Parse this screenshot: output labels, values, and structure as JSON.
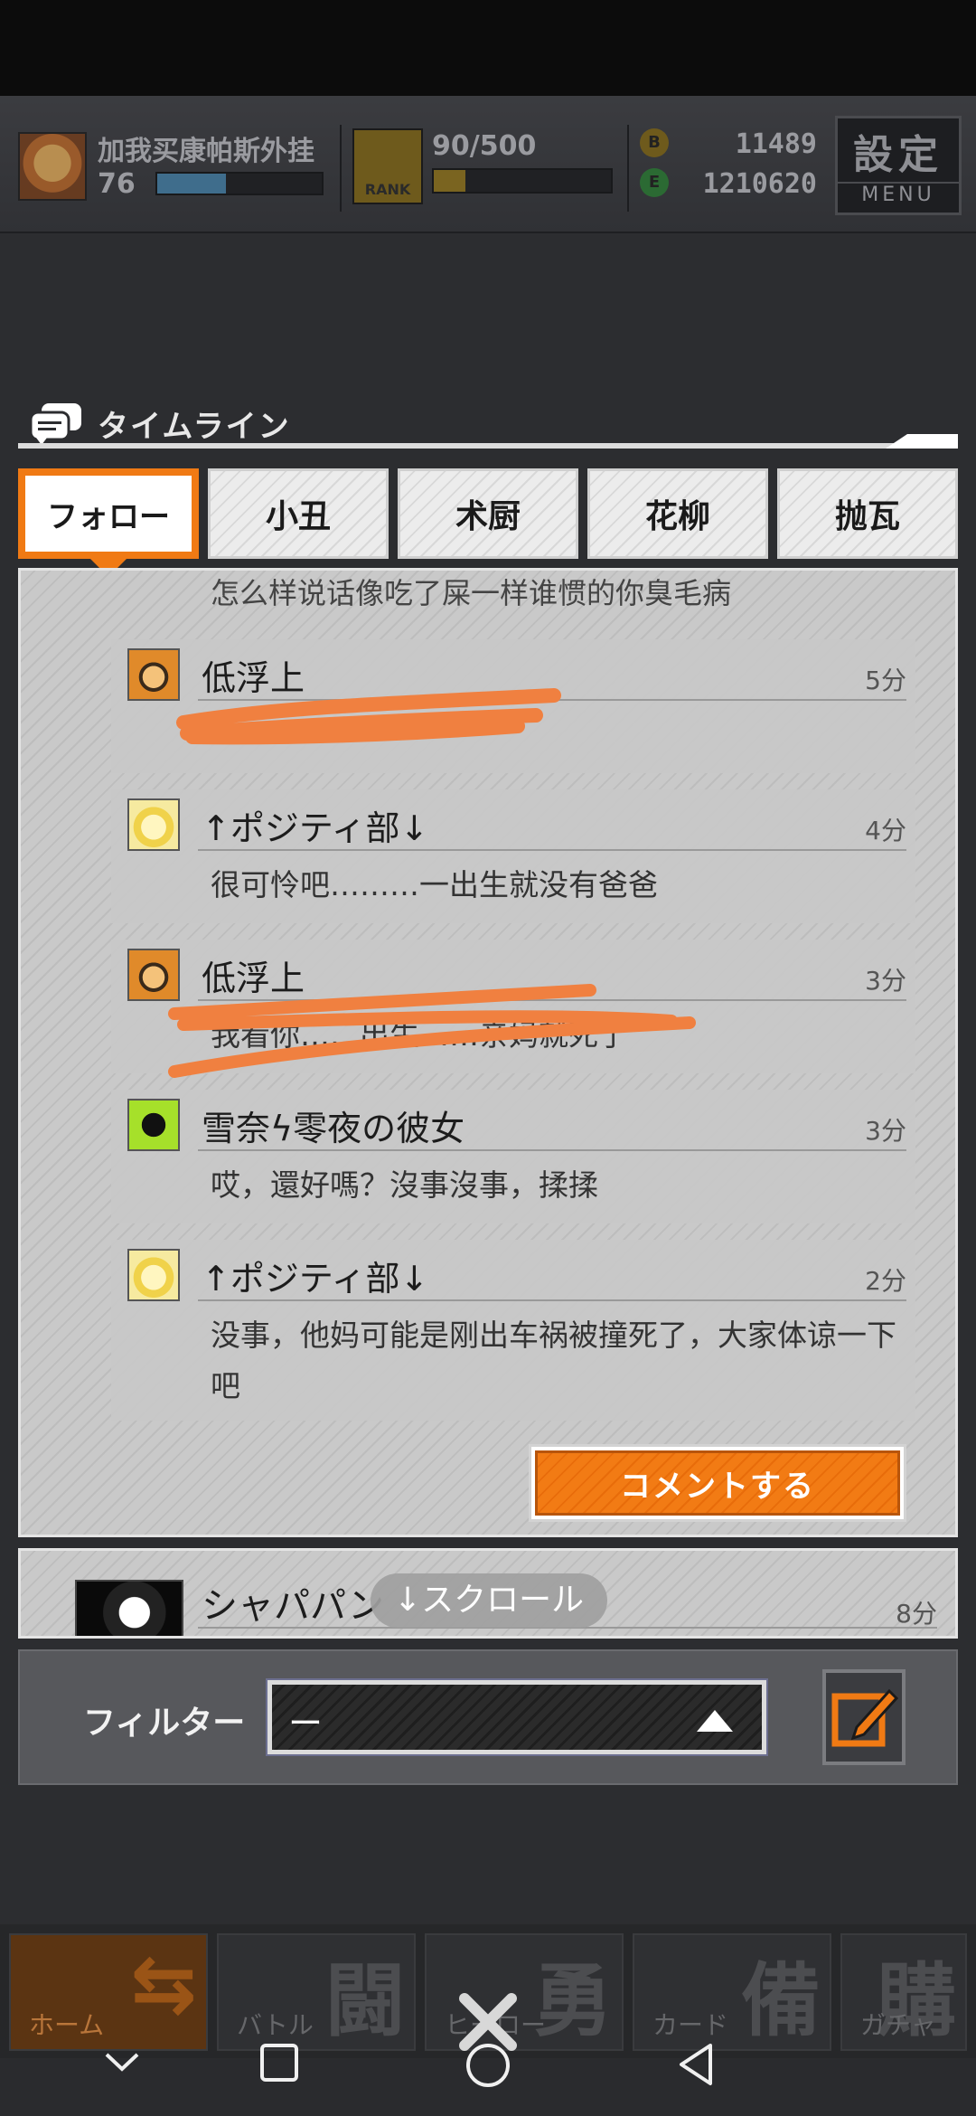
{
  "player": {
    "name": "加我买康帕斯外挂",
    "level": "76"
  },
  "rank": {
    "badge": "RANK",
    "exp": "90/500"
  },
  "currency": {
    "gold_icon": "B",
    "gold": "11489",
    "green_icon": "E",
    "green": "1210620"
  },
  "menu": {
    "kanji": "設定",
    "label": "MENU"
  },
  "timeline": {
    "title": "タイムライン"
  },
  "tabs": [
    {
      "label": "フォロー",
      "active": true
    },
    {
      "label": "小丑"
    },
    {
      "label": "术厨"
    },
    {
      "label": "花柳"
    },
    {
      "label": "抛瓦"
    }
  ],
  "feed": {
    "previous_text": "怎么样说话像吃了屎一样谁惯的你臭毛病",
    "posts": [
      {
        "name": "低浮上",
        "time": "5分",
        "message": "",
        "avatar": "orange-hood-avatar"
      },
      {
        "name": "↑ポジティ部↓",
        "time": "4分",
        "message": "很可怜吧………一出生就没有爸爸",
        "avatar": "yellow-hair-avatar"
      },
      {
        "name": "低浮上",
        "time": "3分",
        "message": "我看你……出生……亲妈就死了",
        "avatar": "orange-hood-avatar"
      },
      {
        "name": "雪奈ϟ零夜の彼女",
        "time": "3分",
        "message": "哎，還好嗎？沒事沒事，揉揉",
        "avatar": "green-avatar"
      },
      {
        "name": "↑ポジティ部↓",
        "time": "2分",
        "message": "没事，他妈可能是刚出车祸被撞死了，大家体谅一下吧",
        "avatar": "yellow-hair-avatar"
      }
    ],
    "comment_button": "コメントする"
  },
  "next_post": {
    "name": "シャパパン",
    "time": "8分"
  },
  "scroll_hint": "↓スクロール",
  "filter": {
    "label": "フィルター",
    "value": "ー"
  },
  "bottom_nav": [
    {
      "big": "⇆",
      "small": "ホーム"
    },
    {
      "big": "闘",
      "small": "バトル"
    },
    {
      "big": "勇",
      "small": "ヒーロー"
    },
    {
      "big": "備",
      "small": "カード"
    },
    {
      "big": "購",
      "small": "ガチャ"
    }
  ],
  "colors": {
    "accent": "#f07a14",
    "background": "#2c2d30",
    "panel": "#c9c9c9",
    "scribble": "#f08040"
  }
}
